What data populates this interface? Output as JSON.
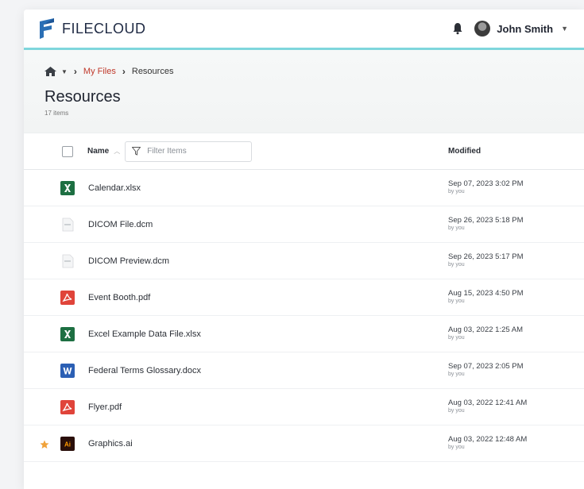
{
  "app": {
    "logo_text_a": "FILE",
    "logo_text_b": "CLOUD",
    "brand_color": "#2a6fb5",
    "accent_color": "#7fd6dc"
  },
  "user": {
    "name": "John Smith"
  },
  "breadcrumb": {
    "my_files": "My Files",
    "current": "Resources"
  },
  "page": {
    "title": "Resources",
    "item_count": "17 items"
  },
  "table": {
    "col_name": "Name",
    "filter_placeholder": "Filter Items",
    "col_modified": "Modified",
    "rows": [
      {
        "name": "Calendar.xlsx",
        "type": "excel",
        "date": "Sep 07, 2023 3:02 PM",
        "by": "by you",
        "starred": false
      },
      {
        "name": "DICOM File.dcm",
        "type": "dicom",
        "date": "Sep 26, 2023 5:18 PM",
        "by": "by you",
        "starred": false
      },
      {
        "name": "DICOM Preview.dcm",
        "type": "dicom",
        "date": "Sep 26, 2023 5:17 PM",
        "by": "by you",
        "starred": false
      },
      {
        "name": "Event Booth.pdf",
        "type": "pdf",
        "date": "Aug 15, 2023 4:50 PM",
        "by": "by you",
        "starred": false
      },
      {
        "name": "Excel Example Data File.xlsx",
        "type": "excel",
        "date": "Aug 03, 2022 1:25 AM",
        "by": "by you",
        "starred": false
      },
      {
        "name": "Federal Terms Glossary.docx",
        "type": "word",
        "date": "Sep 07, 2023 2:05 PM",
        "by": "by you",
        "starred": false
      },
      {
        "name": "Flyer.pdf",
        "type": "pdf",
        "date": "Aug 03, 2022 12:41 AM",
        "by": "by you",
        "starred": false
      },
      {
        "name": "Graphics.ai",
        "type": "illustrator",
        "date": "Aug 03, 2022 12:48 AM",
        "by": "by you",
        "starred": true
      }
    ]
  }
}
